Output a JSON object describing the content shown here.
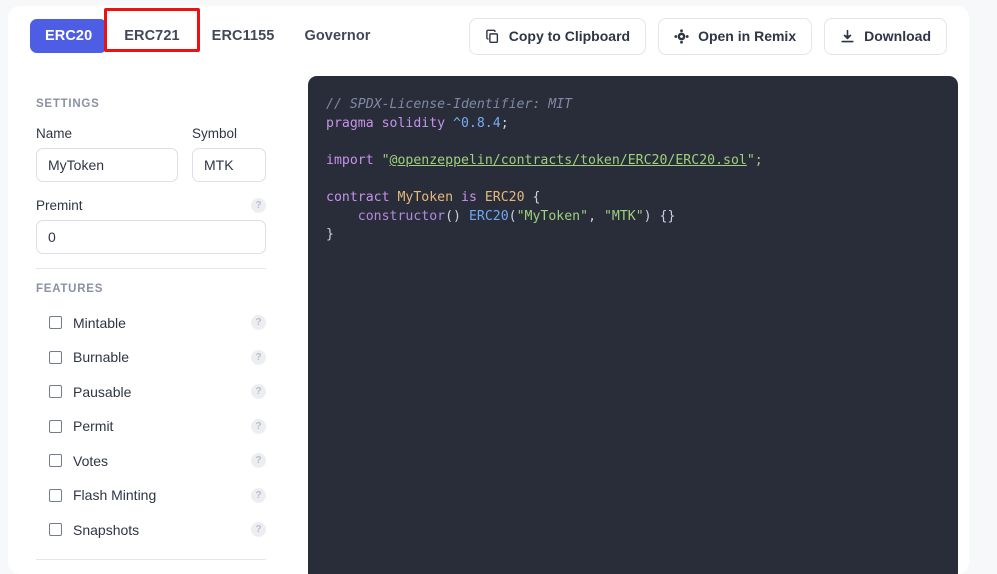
{
  "header": {
    "tabs": [
      {
        "label": "ERC20",
        "active": true,
        "highlighted": false
      },
      {
        "label": "ERC721",
        "active": false,
        "highlighted": true
      },
      {
        "label": "ERC1155",
        "active": false,
        "highlighted": false
      },
      {
        "label": "Governor",
        "active": false,
        "highlighted": false
      }
    ],
    "actions": [
      {
        "label": "Copy to Clipboard",
        "icon": "copy-icon"
      },
      {
        "label": "Open in Remix",
        "icon": "remix-icon"
      },
      {
        "label": "Download",
        "icon": "download-icon"
      }
    ]
  },
  "sidebar": {
    "settings_heading": "SETTINGS",
    "name_label": "Name",
    "name_value": "MyToken",
    "symbol_label": "Symbol",
    "symbol_value": "MTK",
    "premint_label": "Premint",
    "premint_value": "0",
    "help_glyph": "?",
    "features_heading": "FEATURES",
    "features": [
      {
        "label": "Mintable",
        "checked": false
      },
      {
        "label": "Burnable",
        "checked": false
      },
      {
        "label": "Pausable",
        "checked": false
      },
      {
        "label": "Permit",
        "checked": false
      },
      {
        "label": "Votes",
        "checked": false
      },
      {
        "label": "Flash Minting",
        "checked": false
      },
      {
        "label": "Snapshots",
        "checked": false
      }
    ]
  },
  "code": {
    "comment": "// SPDX-License-Identifier: MIT",
    "pragma_kw": "pragma solidity",
    "pragma_version": "^0.8.4",
    "pragma_semi": ";",
    "import_kw": "import",
    "import_open_quote": "\"",
    "import_path": "@openzeppelin/contracts/token/ERC20/ERC20.sol",
    "import_close": "\";",
    "contract_kw": "contract",
    "contract_name": "MyToken",
    "is_kw": "is",
    "base_type": "ERC20",
    "open_brace": "{",
    "constructor_kw": "constructor",
    "constructor_params": "()",
    "ctor_call": "ERC20",
    "ctor_open": "(",
    "ctor_arg_name": "\"MyToken\"",
    "ctor_comma": ", ",
    "ctor_arg_symbol": "\"MTK\"",
    "ctor_close": ") {}",
    "close_brace": "}"
  },
  "colors": {
    "page_bg": "#f7f8fa",
    "card_bg": "#ffffff",
    "accent": "#4e5ee4",
    "highlight_box": "#ee1111",
    "editor_bg": "#292d3a"
  }
}
